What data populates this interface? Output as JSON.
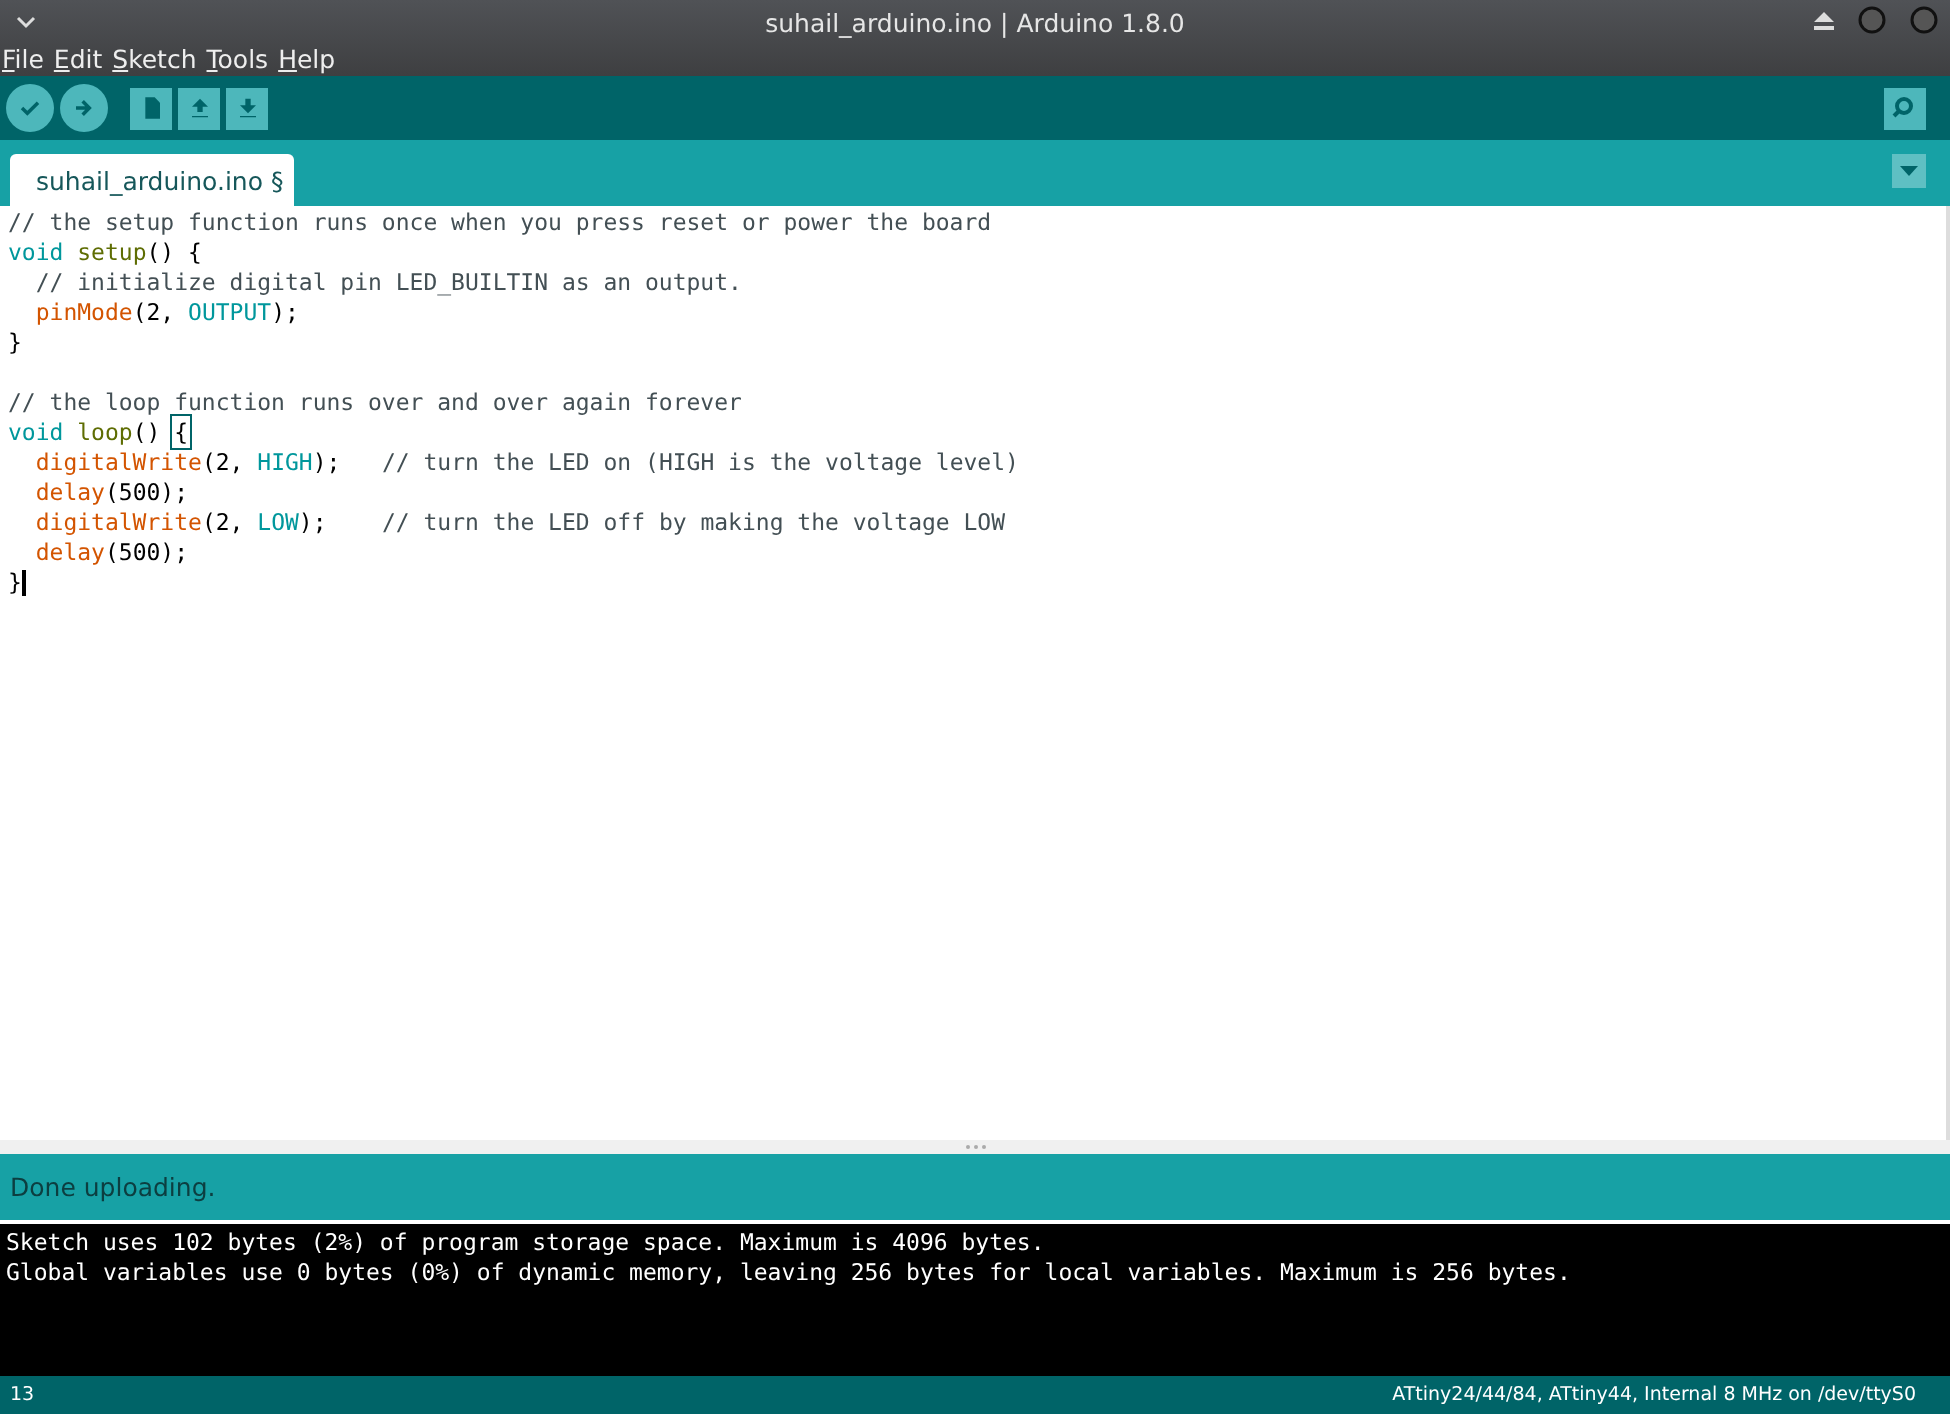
{
  "window": {
    "title": "suhail_arduino.ino | Arduino 1.8.0"
  },
  "menu": [
    "File",
    "Edit",
    "Sketch",
    "Tools",
    "Help"
  ],
  "toolbar": [
    {
      "kind": "verify"
    },
    {
      "kind": "upload"
    },
    {
      "kind": "new"
    },
    {
      "kind": "open"
    },
    {
      "kind": "save"
    }
  ],
  "tabs": [
    {
      "label": "suhail_arduino.ino §",
      "selected": true
    }
  ],
  "editor": {
    "blocks": [
      {
        "lines": [
          {
            "indent": false,
            "tokens": [
              {
                "kind": "comment",
                "text": "// the setup function runs once when you press reset or power the board"
              }
            ]
          },
          {
            "indent": false,
            "tokens": [
              {
                "kind": "keyword",
                "text": "void "
              },
              {
                "kind": "function",
                "text": "setup"
              },
              {
                "kind": "plain",
                "text": "() {"
              }
            ]
          },
          {
            "indent": true,
            "tokens": [
              {
                "kind": "comment",
                "text": "// initialize digital pin LED_BUILTIN as an output."
              }
            ]
          },
          {
            "indent": true,
            "tokens": [
              {
                "kind": "builtin",
                "text": "pinMode"
              },
              {
                "kind": "plain",
                "text": "(2, "
              },
              {
                "kind": "keyword",
                "text": "OUTPUT"
              },
              {
                "kind": "plain",
                "text": ");"
              }
            ]
          },
          {
            "indent": false,
            "tokens": [
              {
                "kind": "plain",
                "text": "}"
              }
            ]
          }
        ]
      },
      {
        "lines": [
          {
            "indent": false,
            "tokens": [
              {
                "kind": "comment",
                "text": "// the loop function runs over and over again forever"
              }
            ]
          },
          {
            "indent": false,
            "tokens": [
              {
                "kind": "keyword",
                "text": "void "
              },
              {
                "kind": "function",
                "text": "loop"
              },
              {
                "kind": "plain",
                "text": "() "
              },
              {
                "kind": "match",
                "text": "{"
              }
            ]
          },
          {
            "indent": true,
            "tokens": [
              {
                "kind": "builtin",
                "text": "digitalWrite"
              },
              {
                "kind": "plain",
                "text": "(2, "
              },
              {
                "kind": "keyword",
                "text": "HIGH"
              },
              {
                "kind": "plain",
                "text": ");   "
              },
              {
                "kind": "comment",
                "text": "// turn the LED on (HIGH is the voltage level)"
              }
            ]
          },
          {
            "indent": true,
            "tokens": [
              {
                "kind": "builtin",
                "text": "delay"
              },
              {
                "kind": "plain",
                "text": "(500);"
              }
            ]
          },
          {
            "indent": true,
            "tokens": [
              {
                "kind": "builtin",
                "text": "digitalWrite"
              },
              {
                "kind": "plain",
                "text": "(2, "
              },
              {
                "kind": "keyword",
                "text": "LOW"
              },
              {
                "kind": "plain",
                "text": ");    "
              },
              {
                "kind": "comment",
                "text": "// turn the LED off by making the voltage LOW"
              }
            ]
          },
          {
            "indent": true,
            "tokens": [
              {
                "kind": "builtin",
                "text": "delay"
              },
              {
                "kind": "plain",
                "text": "(500);"
              }
            ]
          },
          {
            "indent": false,
            "tokens": [
              {
                "kind": "plain",
                "text": "}"
              }
            ],
            "caret": true
          }
        ]
      }
    ]
  },
  "status": "Done uploading.",
  "console": [
    "Sketch uses 102 bytes (2%) of program storage space. Maximum is 4096 bytes.",
    "Global variables use 0 bytes (0%) of dynamic memory, leaving 256 bytes for local variables. Maximum is 256 bytes."
  ],
  "status_bar": {
    "line": "13",
    "board": "ATtiny24/44/84, ATtiny44, Internal 8 MHz on /dev/ttyS0"
  }
}
